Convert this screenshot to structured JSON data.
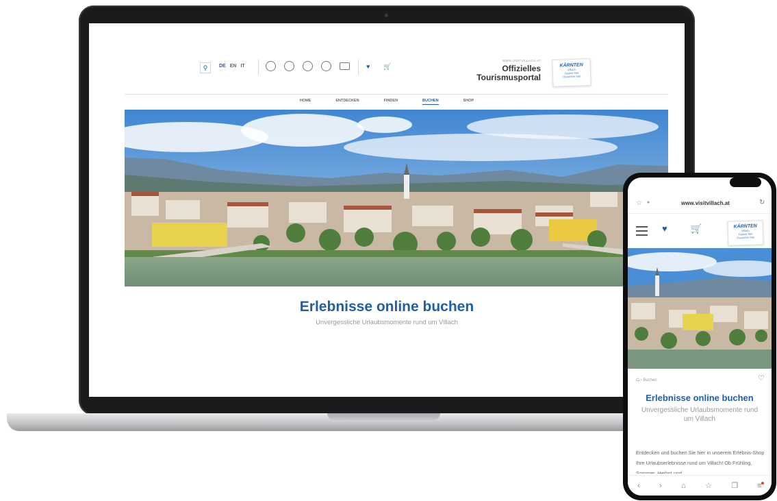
{
  "desktop": {
    "languages": [
      {
        "code": "DE",
        "active": true
      },
      {
        "code": "EN",
        "active": false
      },
      {
        "code": "IT",
        "active": false
      }
    ],
    "header_icons": [
      "lightbulb-icon",
      "sun-cloud-icon",
      "location-icon",
      "flower-icon",
      "bed-icon"
    ],
    "brand": {
      "url": "WWW.VISITVILLACH.AT",
      "line1": "Offizielles",
      "line2": "Tourismusportal"
    },
    "logo": {
      "wordmark": "KÄRNTEN",
      "lines": [
        "Villach",
        "Faaker See",
        "Ossiacher See"
      ]
    },
    "nav": [
      {
        "label": "HOME",
        "active": false
      },
      {
        "label": "ENTDECKEN",
        "active": false
      },
      {
        "label": "FINDEN",
        "active": false
      },
      {
        "label": "BUCHEN",
        "active": true
      },
      {
        "label": "SHOP",
        "active": false
      }
    ],
    "hero_image": "villach-panorama-river-church-mountains",
    "title": "Erlebnisse online buchen",
    "subtitle": "Unvergessliche Urlaubsmomente rund um Villach"
  },
  "mobile": {
    "url": "www.visitvillach.at",
    "logo": {
      "wordmark": "KÄRNTEN",
      "lines": [
        "Villach",
        "Faaker See",
        "Ossiacher See"
      ]
    },
    "breadcrumb": "Buchen",
    "title": "Erlebnisse online buchen",
    "subtitle": "Unvergessliche Urlaubsmomente rund um Villach",
    "body": "Entdecken und buchen Sie hier in unserem Erlebnis-Shop Ihre Urlaubserlebnisse rund um Villach! Ob Frühling, Sommer, Herbst und",
    "bottom_icons": [
      "back-icon",
      "forward-icon",
      "home-icon",
      "star-icon",
      "tabs-icon",
      "menu-icon"
    ]
  },
  "colors": {
    "brand_blue": "#1f5fa8",
    "text_gray": "#999999",
    "device_black": "#1b1b1d"
  }
}
